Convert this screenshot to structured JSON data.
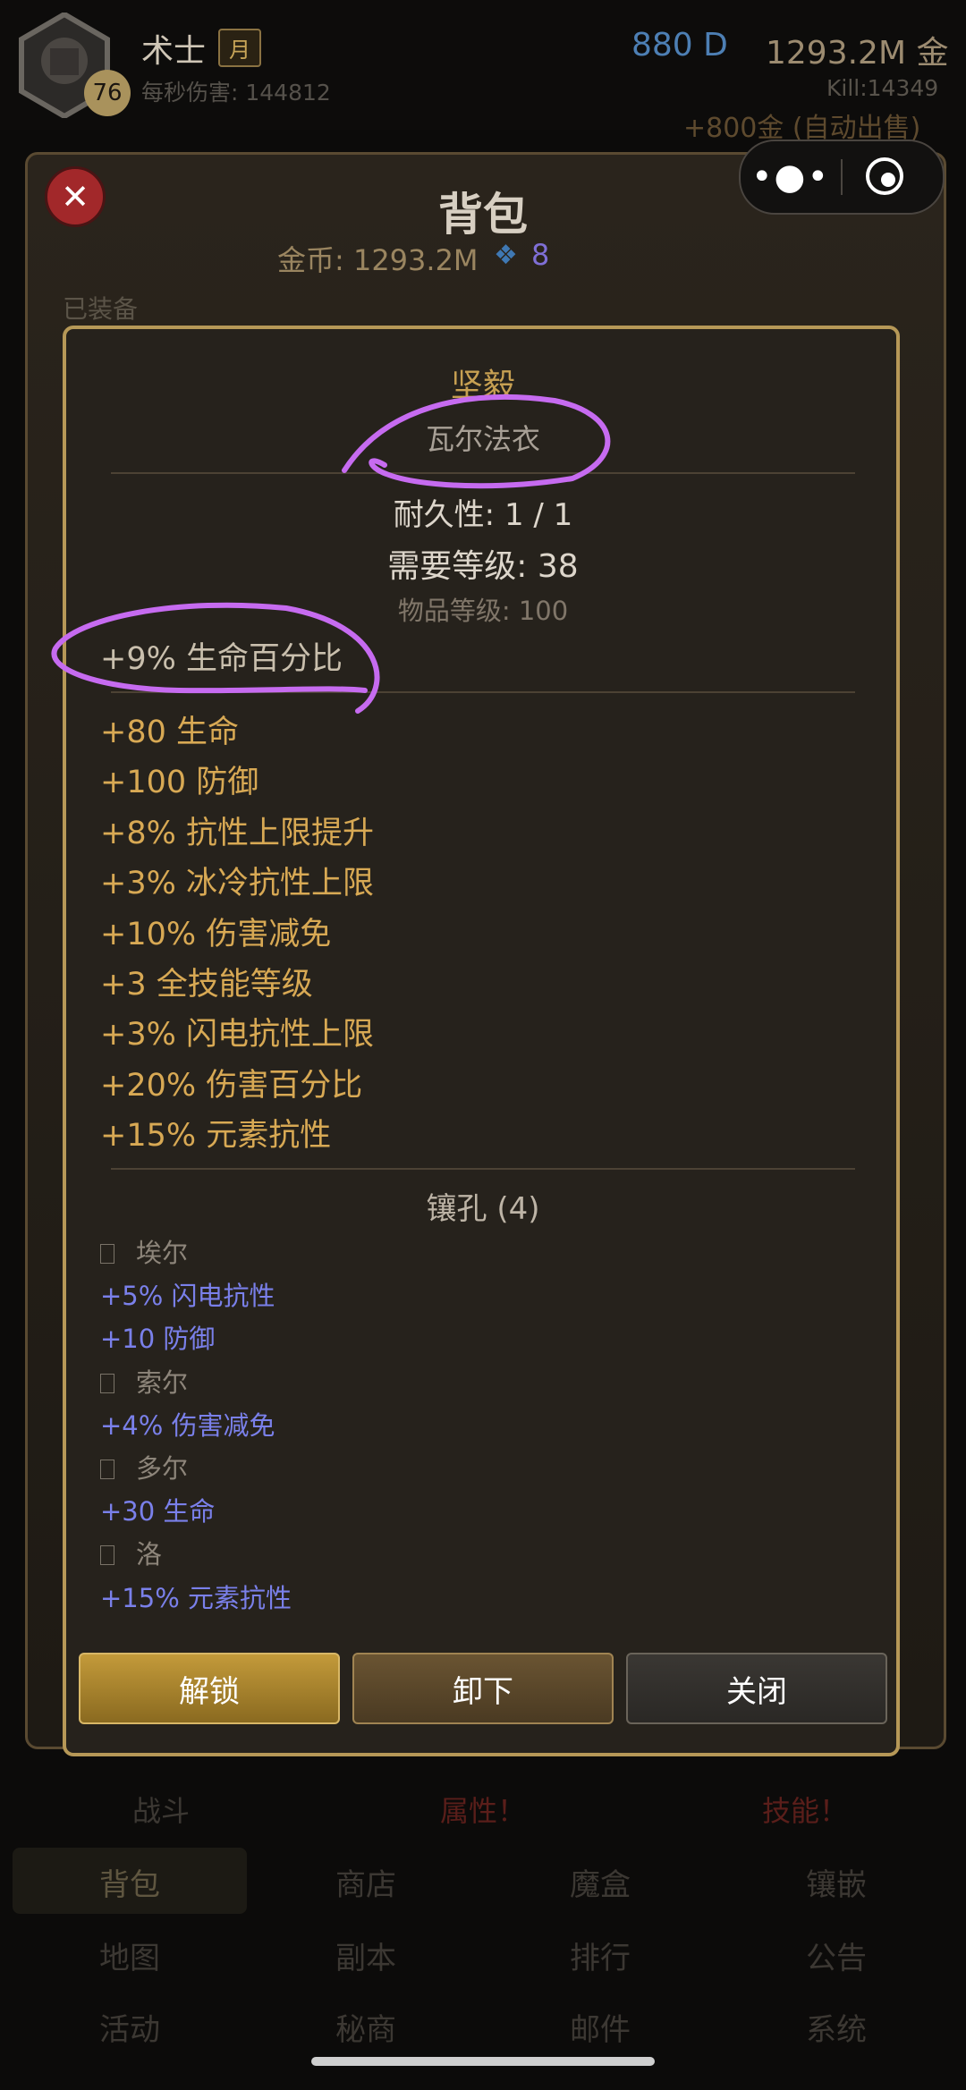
{
  "header": {
    "char_name": "术士",
    "class_badge": "月",
    "level": "76",
    "dps_label": "每秒伤害: 144812",
    "diamonds": "880 D",
    "gold": "1293.2M 金",
    "kills": "Kill:14349",
    "autosell": "+800金 (自动出售)"
  },
  "bag": {
    "title": "背包",
    "gold": "金币: 1293.2M",
    "gems": "8",
    "equipped_label": "已装备",
    "close_symbol": "✕"
  },
  "capsule": {
    "more": "•●•"
  },
  "item": {
    "name": "坚毅",
    "base": "瓦尔法衣",
    "durability": "耐久性: 1 / 1",
    "required_level": "需要等级: 38",
    "item_level": "物品等级: 100",
    "implicit": "+9% 生命百分比",
    "affixes": [
      "+80 生命",
      "+100 防御",
      "+8% 抗性上限提升",
      "+3% 冰冷抗性上限",
      "+10% 伤害减免",
      "+3 全技能等级",
      "+3% 闪电抗性上限",
      "+20% 伤害百分比",
      "+15% 元素抗性"
    ],
    "sockets_title": "镶孔 (4)",
    "sockets": [
      {
        "rune": "埃尔",
        "stats": [
          "+5% 闪电抗性",
          "+10 防御"
        ]
      },
      {
        "rune": "索尔",
        "stats": [
          "+4% 伤害减免"
        ]
      },
      {
        "rune": "多尔",
        "stats": [
          "+30 生命"
        ]
      },
      {
        "rune": "洛",
        "stats": [
          "+15% 元素抗性"
        ]
      }
    ],
    "buttons": {
      "unlock": "解锁",
      "unequip": "卸下",
      "close": "关闭"
    }
  },
  "bottom_nav": {
    "tabs": [
      "战斗",
      "属性！",
      "技能！"
    ],
    "grid": [
      "背包",
      "商店",
      "魔盒",
      "镶嵌",
      "地图",
      "副本",
      "排行",
      "公告",
      "活动",
      "秘商",
      "邮件",
      "系统"
    ]
  },
  "colors": {
    "accent_gold": "#c7a052",
    "affix": "#d8a954",
    "rune_stat": "#7a80ea",
    "close_red": "#a2282a",
    "annotation": "#c66bf0"
  }
}
